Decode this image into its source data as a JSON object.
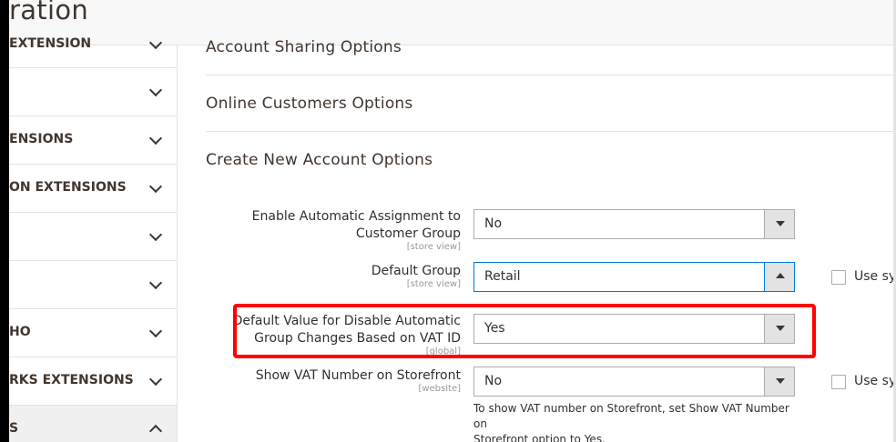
{
  "header": {
    "title": "ration"
  },
  "sidebar": {
    "items": [
      {
        "label": "EXTENSION",
        "expanded": false
      },
      {
        "label": "",
        "expanded": false
      },
      {
        "label": "ENSIONS",
        "expanded": false
      },
      {
        "label": "ON EXTENSIONS",
        "expanded": false
      },
      {
        "label": "",
        "expanded": false
      },
      {
        "label": "",
        "expanded": false
      },
      {
        "label": "HO",
        "expanded": false
      },
      {
        "label": "RKS EXTENSIONS",
        "expanded": false
      },
      {
        "label": "S",
        "expanded": true
      }
    ]
  },
  "sections": {
    "account_sharing": "Account Sharing Options",
    "online_customers": "Online Customers Options",
    "create_new_account": "Create New Account Options"
  },
  "fields": {
    "auto_assign": {
      "label_line1": "Enable Automatic Assignment to",
      "label_line2": "Customer Group",
      "scope": "[store view]",
      "value": "No"
    },
    "default_group": {
      "label": "Default Group",
      "scope": "[store view]",
      "value": "Retail",
      "use_system": "Use sys"
    },
    "disable_auto_group": {
      "label_line1": "Default Value for Disable Automatic",
      "label_line2": "Group Changes Based on VAT ID",
      "scope": "[global]",
      "value": "Yes"
    },
    "show_vat": {
      "label": "Show VAT Number on Storefront",
      "scope": "[website]",
      "value": "No",
      "use_system": "Use sys",
      "note_line1": "To show VAT number on Storefront, set Show VAT Number on",
      "note_line2": "Storefront option to Yes."
    }
  },
  "colors": {
    "highlight": "#ff0000",
    "focus_border": "#007bdb",
    "select_border": "#adadad"
  }
}
